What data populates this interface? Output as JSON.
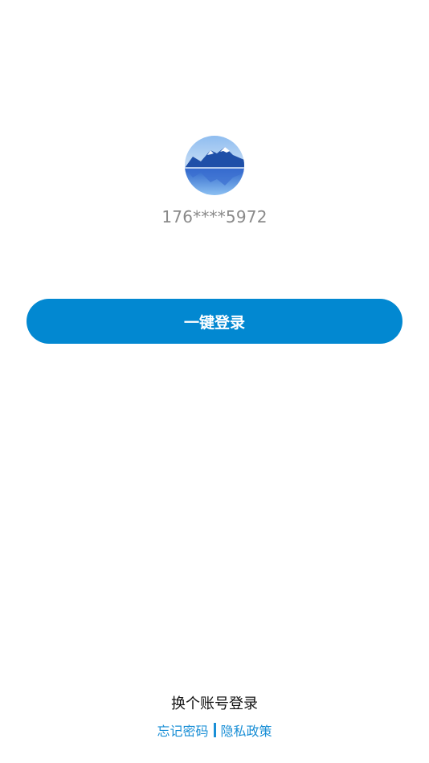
{
  "account": {
    "avatar_icon": "mountain-lake-avatar",
    "masked_phone": "176****5972"
  },
  "actions": {
    "one_click_login_label": "一键登录",
    "switch_account_label": "换个账号登录"
  },
  "footer": {
    "forgot_password_label": "忘记密码",
    "privacy_policy_label": "隐私政策"
  },
  "colors": {
    "primary": "#0288d1",
    "link": "#1a8fd6",
    "phone_text": "#8a8a8a"
  }
}
